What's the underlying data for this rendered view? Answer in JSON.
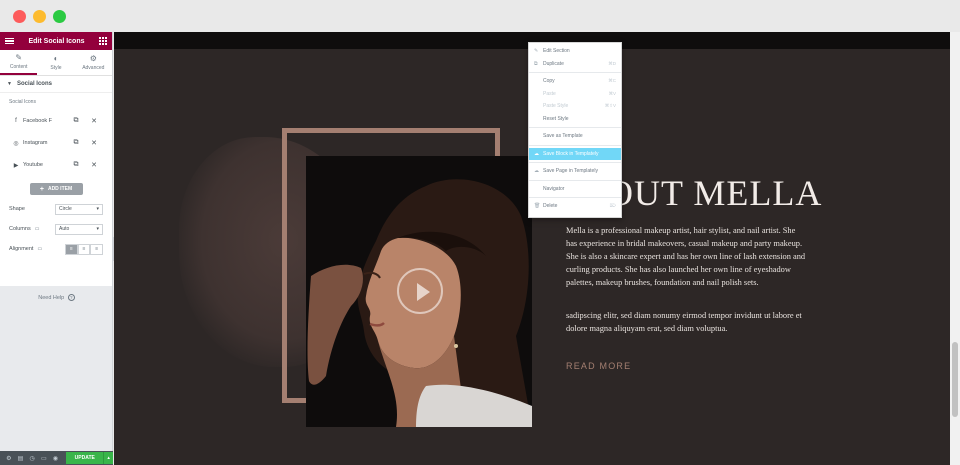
{
  "sidebar": {
    "header_title": "Edit Social Icons",
    "tabs": [
      {
        "label": "Content",
        "icon": "pencil-icon"
      },
      {
        "label": "Style",
        "icon": "half-circle-icon"
      },
      {
        "label": "Advanced",
        "icon": "gear-icon"
      }
    ],
    "section_title": "Social Icons",
    "repeater_label": "Social Icons",
    "items": [
      {
        "brand_glyph": "f",
        "label": "Facebook F"
      },
      {
        "brand_glyph": "◎",
        "label": "Instagram"
      },
      {
        "brand_glyph": "▶",
        "label": "Youtube"
      }
    ],
    "add_item_label": "ADD ITEM",
    "shape_label": "Shape",
    "shape_value": "Circle",
    "columns_label": "Columns",
    "columns_value": "Auto",
    "alignment_label": "Alignment",
    "need_help": "Need Help",
    "update_label": "UPDATE"
  },
  "page": {
    "heading": "OUT MELLA",
    "paragraph1": "Mella is a professional makeup artist, hair stylist, and nail artist. She has experience in bridal makeovers, casual makeup and party makeup. She is also a skincare expert and has her own line of lash extension and curling products. She has also launched her own line of eyeshadow palettes, makeup brushes, foundation and nail polish sets.",
    "paragraph2": "sadipscing elitr, sed diam nonumy eirmod tempor invidunt ut labore et dolore magna aliquyam erat, sed diam voluptua.",
    "read_more": "READ MORE"
  },
  "context_menu": {
    "items": [
      {
        "label": "Edit Section",
        "shortcut": "",
        "icon": "pencil-icon",
        "disabled": false,
        "highlight": false
      },
      {
        "label": "Duplicate",
        "shortcut": "⌘D",
        "icon": "copy-icon",
        "disabled": false,
        "highlight": false
      },
      {
        "sep": true
      },
      {
        "label": "Copy",
        "shortcut": "⌘C",
        "icon": "",
        "disabled": false,
        "highlight": false
      },
      {
        "label": "Paste",
        "shortcut": "⌘V",
        "icon": "",
        "disabled": true,
        "highlight": false
      },
      {
        "label": "Paste Style",
        "shortcut": "⌘⇧V",
        "icon": "",
        "disabled": true,
        "highlight": false
      },
      {
        "label": "Reset Style",
        "shortcut": "",
        "icon": "",
        "disabled": false,
        "highlight": false
      },
      {
        "sep": true
      },
      {
        "label": "Save as Template",
        "shortcut": "",
        "icon": "",
        "disabled": false,
        "highlight": false
      },
      {
        "sep": true
      },
      {
        "label": "Save Block in Templately",
        "shortcut": "",
        "icon": "cloud-icon",
        "disabled": false,
        "highlight": true
      },
      {
        "sep": true
      },
      {
        "label": "Save Page in Templately",
        "shortcut": "",
        "icon": "cloud-icon",
        "disabled": false,
        "highlight": false
      },
      {
        "sep": true
      },
      {
        "label": "Navigator",
        "shortcut": "",
        "icon": "",
        "disabled": false,
        "highlight": false
      },
      {
        "sep": true
      },
      {
        "label": "Delete",
        "shortcut": "⌦",
        "icon": "trash-icon",
        "disabled": false,
        "highlight": false
      }
    ]
  },
  "colors": {
    "brand": "#93003c",
    "canvas_bg": "#2d2726",
    "accent": "#a47f71",
    "highlight": "#71d7f7",
    "update_green": "#39b54a"
  }
}
